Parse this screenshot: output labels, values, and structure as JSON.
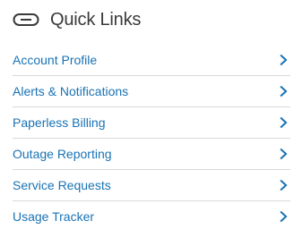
{
  "header": {
    "title": "Quick Links",
    "icon": "link-icon"
  },
  "colors": {
    "link": "#1a73b5",
    "title": "#3a3a3a",
    "divider": "#d9d9d9",
    "chevron": "#1a73b5"
  },
  "links": [
    {
      "label": "Account Profile",
      "icon": "chevron-right-icon"
    },
    {
      "label": "Alerts & Notifications",
      "icon": "chevron-right-icon"
    },
    {
      "label": "Paperless Billing",
      "icon": "chevron-right-icon"
    },
    {
      "label": "Outage Reporting",
      "icon": "chevron-right-icon"
    },
    {
      "label": "Service Requests",
      "icon": "chevron-right-icon"
    },
    {
      "label": "Usage Tracker",
      "icon": "chevron-right-icon"
    }
  ]
}
